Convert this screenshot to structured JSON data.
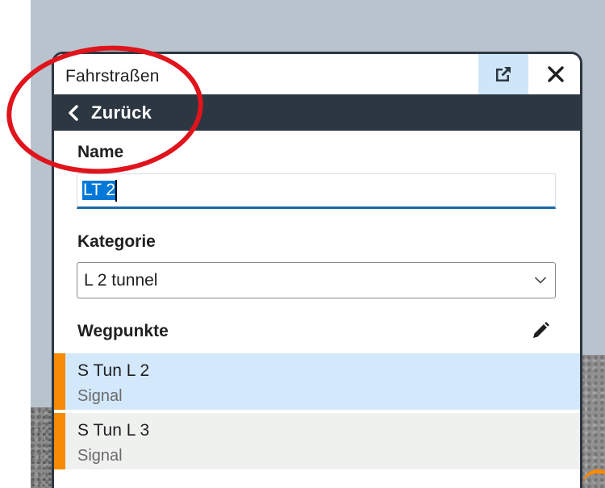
{
  "window": {
    "title": "Fahrstraßen",
    "popout_icon": "external-link-icon",
    "close_icon": "close-icon"
  },
  "nav": {
    "back_label": "Zurück",
    "back_icon": "chevron-left-icon"
  },
  "form": {
    "name_label": "Name",
    "name_value": "LT 2",
    "category_label": "Kategorie",
    "category_value": "L 2 tunnel",
    "waypoints_label": "Wegpunkte",
    "edit_icon": "pencil-icon"
  },
  "waypoints": [
    {
      "name": "S Tun L 2",
      "type": "Signal",
      "selected": true
    },
    {
      "name": "S Tun L 3",
      "type": "Signal",
      "selected": false
    }
  ],
  "colors": {
    "header_dark": "#2d3742",
    "accent_orange": "#f58a07",
    "selected_row": "#d3e8fb",
    "unselected_row": "#eff1ef",
    "popout_highlight": "#cfe5f8",
    "selection_blue": "#0078d7",
    "annotation_red": "#e0141c"
  }
}
